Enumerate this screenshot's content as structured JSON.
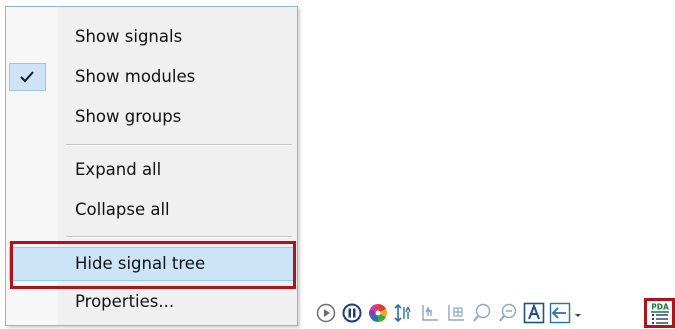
{
  "context_menu": {
    "items": [
      {
        "label": "Show signals",
        "checked": false
      },
      {
        "label": "Show modules",
        "checked": true
      },
      {
        "label": "Show groups",
        "checked": false
      },
      {
        "label": "Expand all",
        "checked": false
      },
      {
        "label": "Collapse all",
        "checked": false
      },
      {
        "label": "Hide signal tree",
        "checked": false,
        "highlighted": true
      },
      {
        "label": "Properties...",
        "checked": false
      }
    ]
  },
  "toolbar": {
    "icons": [
      "play-icon",
      "pause-icon",
      "color-wheel-icon",
      "sort-y-axis-icon",
      "fit-axis-icon",
      "zoom-fit-icon",
      "zoom-in-icon",
      "zoom-out-icon",
      "text-a-icon",
      "back-arrow-icon",
      "pda-list-icon"
    ],
    "pda_label": "PDA"
  },
  "colors": {
    "highlight": "#cce4f7",
    "highlight_outline": "#b3121a",
    "icon": "#2b6fb0",
    "menu_border": "#8fb3da"
  }
}
